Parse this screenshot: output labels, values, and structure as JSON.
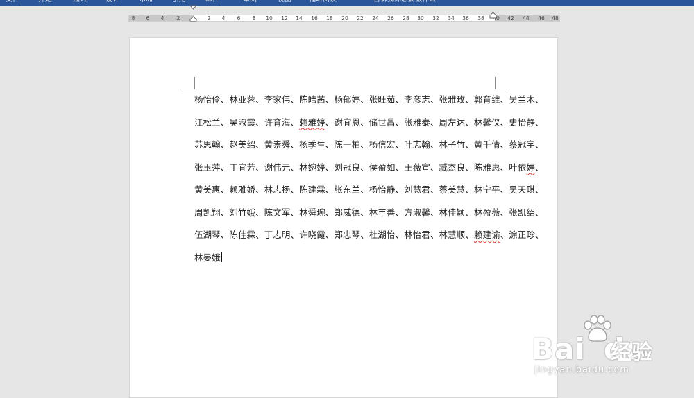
{
  "ribbon": {
    "tabs": [
      "文件",
      "开始",
      "插入",
      "设计",
      "布局",
      "引用",
      "邮件",
      "审阅",
      "视图",
      "福昕阅读"
    ],
    "tell_me": "告诉我你想要做什么",
    "accent_color": "#2b579a"
  },
  "ruler": {
    "numbers": [
      "8",
      "6",
      "4",
      "2",
      "2",
      "4",
      "6",
      "8",
      "10",
      "12",
      "14",
      "16",
      "18",
      "20",
      "22",
      "24",
      "26",
      "28",
      "30",
      "32",
      "34",
      "36",
      "38",
      "40",
      "42",
      "44",
      "46",
      "48"
    ]
  },
  "document": {
    "lines": [
      [
        "杨怡伶、林亚蓉、李家伟、陈皓茜、杨郁婷、张旺茹、李彦志、张雅玫、郭育维、吴兰木、"
      ],
      [
        "江松兰、吴淑霞、许育海、",
        {
          "t": "赖雅婷",
          "sq": true
        },
        "、谢宜恩、储世昌、张雅泰、周左达、林馨仪、史怡静、"
      ],
      [
        "苏思翰、赵美绍、黄崇舜、杨季生、陈一柏、杨信宏、叶志翰、林子竹、黄千倩、蔡冠宇、"
      ],
      [
        "张玉萍、丁宜芳、谢伟元、林婉婷、刘冠良、侯盈如、王薇宣、臧杰良、陈雅惠、叶依",
        {
          "t": "婷",
          "sq": true
        },
        "、"
      ],
      [
        "黄美惠、赖雅娇、林志扬、陈建霖、张东兰、杨怡静、刘慧君、蔡美慧、林宁平、吴天琪、"
      ],
      [
        "周凯翔、刘竹娥、陈文军、林舜琬、郑威德、林丰善、方淑馨、林佳颖、林盈薇、张凯绍、"
      ],
      [
        "伍湖琴、陈佳霖、丁志明、许晓霞、郑忠琴、杜湖怡、林怡君、林慧顺、",
        {
          "t": "赖建谕",
          "sq": true
        },
        "、涂正珍、"
      ],
      [
        "林晏娥"
      ]
    ]
  },
  "watermark": {
    "brand": "Bai",
    "brand2": "du",
    "cn": "经验",
    "url": "jingyan.baidu.com"
  }
}
